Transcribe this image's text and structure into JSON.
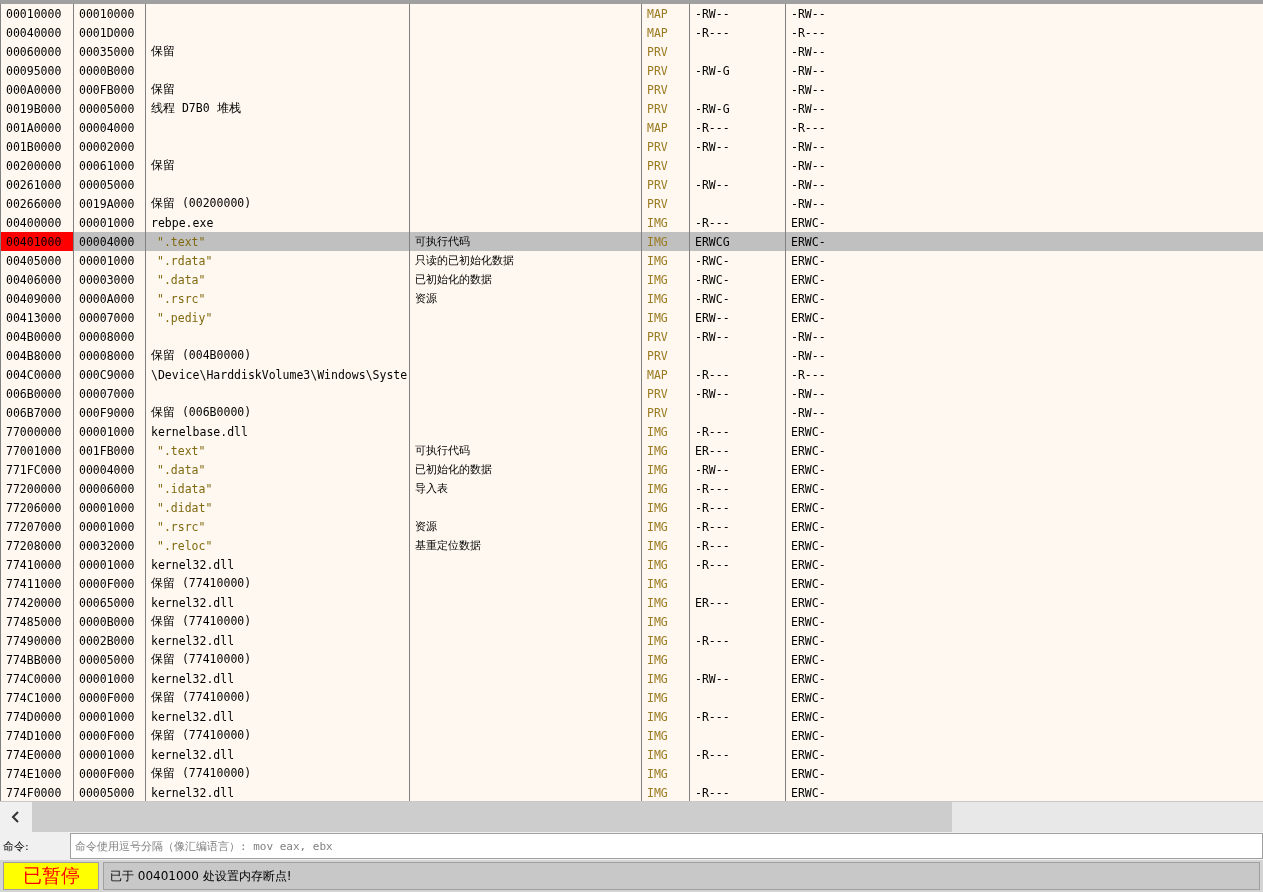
{
  "memory_table": {
    "rows": [
      {
        "column_1": "00010000",
        "column_2": "00010000",
        "column_5": "MAP",
        "column_6": "-RW--",
        "column_7": "-RW--",
        "kind": "plain",
        "selected": false
      },
      {
        "column_1": "00040000",
        "column_2": "0001D000",
        "column_5": "MAP",
        "column_6": "-R---",
        "column_7": "-R---",
        "kind": "plain",
        "selected": false
      },
      {
        "column_1": "00060000",
        "column_2": "00035000",
        "column_3": "保留",
        "column_5": "PRV",
        "column_7": "-RW--",
        "kind": "plain",
        "selected": false
      },
      {
        "column_1": "00095000",
        "column_2": "0000B000",
        "column_5": "PRV",
        "column_6": "-RW-G",
        "column_7": "-RW--",
        "kind": "plain",
        "selected": false
      },
      {
        "column_1": "000A0000",
        "column_2": "000FB000",
        "column_3": "保留",
        "column_5": "PRV",
        "column_7": "-RW--",
        "kind": "plain",
        "selected": false
      },
      {
        "column_1": "0019B000",
        "column_2": "00005000",
        "column_3": "线程 D7B0 堆栈",
        "column_5": "PRV",
        "column_6": "-RW-G",
        "column_7": "-RW--",
        "kind": "plain",
        "selected": false
      },
      {
        "column_1": "001A0000",
        "column_2": "00004000",
        "column_5": "MAP",
        "column_6": "-R---",
        "column_7": "-R---",
        "kind": "plain",
        "selected": false
      },
      {
        "column_1": "001B0000",
        "column_2": "00002000",
        "column_5": "PRV",
        "column_6": "-RW--",
        "column_7": "-RW--",
        "kind": "plain",
        "selected": false
      },
      {
        "column_1": "00200000",
        "column_2": "00061000",
        "column_3": "保留",
        "column_5": "PRV",
        "column_7": "-RW--",
        "kind": "plain",
        "selected": false
      },
      {
        "column_1": "00261000",
        "column_2": "00005000",
        "column_5": "PRV",
        "column_6": "-RW--",
        "column_7": "-RW--",
        "kind": "plain",
        "selected": false
      },
      {
        "column_1": "00266000",
        "column_2": "0019A000",
        "column_3": "保留 (00200000)",
        "column_5": "PRV",
        "column_7": "-RW--",
        "kind": "plain",
        "selected": false
      },
      {
        "column_1": "00400000",
        "column_2": "00001000",
        "column_3": "rebpe.exe",
        "column_5": "IMG",
        "column_6": "-R---",
        "column_7": "ERWC-",
        "kind": "plain",
        "selected": false
      },
      {
        "column_1": "00401000",
        "column_2": "00004000",
        "column_3": "\".text\"",
        "column_4": "可执行代码",
        "column_5": "IMG",
        "column_6": "ERWCG",
        "column_7": "ERWC-",
        "kind": "section",
        "selected": true
      },
      {
        "column_1": "00405000",
        "column_2": "00001000",
        "column_3": "\".rdata\"",
        "column_4": "只读的已初始化数据",
        "column_5": "IMG",
        "column_6": "-RWC-",
        "column_7": "ERWC-",
        "kind": "section",
        "selected": false
      },
      {
        "column_1": "00406000",
        "column_2": "00003000",
        "column_3": "\".data\"",
        "column_4": "已初始化的数据",
        "column_5": "IMG",
        "column_6": "-RWC-",
        "column_7": "ERWC-",
        "kind": "section",
        "selected": false
      },
      {
        "column_1": "00409000",
        "column_2": "0000A000",
        "column_3": "\".rsrc\"",
        "column_4": "资源",
        "column_5": "IMG",
        "column_6": "-RWC-",
        "column_7": "ERWC-",
        "kind": "section",
        "selected": false
      },
      {
        "column_1": "00413000",
        "column_2": "00007000",
        "column_3": "\".pediy\"",
        "column_5": "IMG",
        "column_6": "ERW--",
        "column_7": "ERWC-",
        "kind": "section",
        "selected": false
      },
      {
        "column_1": "004B0000",
        "column_2": "00008000",
        "column_5": "PRV",
        "column_6": "-RW--",
        "column_7": "-RW--",
        "kind": "plain",
        "selected": false
      },
      {
        "column_1": "004B8000",
        "column_2": "00008000",
        "column_3": "保留 (004B0000)",
        "column_5": "PRV",
        "column_7": "-RW--",
        "kind": "plain",
        "selected": false
      },
      {
        "column_1": "004C0000",
        "column_2": "000C9000",
        "column_3": "\\Device\\HarddiskVolume3\\Windows\\Syste",
        "column_5": "MAP",
        "column_6": "-R---",
        "column_7": "-R---",
        "kind": "plain",
        "selected": false
      },
      {
        "column_1": "006B0000",
        "column_2": "00007000",
        "column_5": "PRV",
        "column_6": "-RW--",
        "column_7": "-RW--",
        "kind": "plain",
        "selected": false
      },
      {
        "column_1": "006B7000",
        "column_2": "000F9000",
        "column_3": "保留 (006B0000)",
        "column_5": "PRV",
        "column_7": "-RW--",
        "kind": "plain",
        "selected": false
      },
      {
        "column_1": "77000000",
        "column_2": "00001000",
        "column_3": "kernelbase.dll",
        "column_5": "IMG",
        "column_6": "-R---",
        "column_7": "ERWC-",
        "kind": "plain",
        "selected": false
      },
      {
        "column_1": "77001000",
        "column_2": "001FB000",
        "column_3": "\".text\"",
        "column_4": "可执行代码",
        "column_5": "IMG",
        "column_6": "ER---",
        "column_7": "ERWC-",
        "kind": "section",
        "selected": false
      },
      {
        "column_1": "771FC000",
        "column_2": "00004000",
        "column_3": "\".data\"",
        "column_4": "已初始化的数据",
        "column_5": "IMG",
        "column_6": "-RW--",
        "column_7": "ERWC-",
        "kind": "section",
        "selected": false
      },
      {
        "column_1": "77200000",
        "column_2": "00006000",
        "column_3": "\".idata\"",
        "column_4": "导入表",
        "column_5": "IMG",
        "column_6": "-R---",
        "column_7": "ERWC-",
        "kind": "section",
        "selected": false
      },
      {
        "column_1": "77206000",
        "column_2": "00001000",
        "column_3": "\".didat\"",
        "column_5": "IMG",
        "column_6": "-R---",
        "column_7": "ERWC-",
        "kind": "section",
        "selected": false
      },
      {
        "column_1": "77207000",
        "column_2": "00001000",
        "column_3": "\".rsrc\"",
        "column_4": "资源",
        "column_5": "IMG",
        "column_6": "-R---",
        "column_7": "ERWC-",
        "kind": "section",
        "selected": false
      },
      {
        "column_1": "77208000",
        "column_2": "00032000",
        "column_3": "\".reloc\"",
        "column_4": "基重定位数据",
        "column_5": "IMG",
        "column_6": "-R---",
        "column_7": "ERWC-",
        "kind": "section",
        "selected": false
      },
      {
        "column_1": "77410000",
        "column_2": "00001000",
        "column_3": "kernel32.dll",
        "column_5": "IMG",
        "column_6": "-R---",
        "column_7": "ERWC-",
        "kind": "plain",
        "selected": false
      },
      {
        "column_1": "77411000",
        "column_2": "0000F000",
        "column_3": "保留 (77410000)",
        "column_5": "IMG",
        "column_7": "ERWC-",
        "kind": "plain",
        "selected": false
      },
      {
        "column_1": "77420000",
        "column_2": "00065000",
        "column_3": "kernel32.dll",
        "column_5": "IMG",
        "column_6": "ER---",
        "column_7": "ERWC-",
        "kind": "plain",
        "selected": false
      },
      {
        "column_1": "77485000",
        "column_2": "0000B000",
        "column_3": "保留 (77410000)",
        "column_5": "IMG",
        "column_7": "ERWC-",
        "kind": "plain",
        "selected": false
      },
      {
        "column_1": "77490000",
        "column_2": "0002B000",
        "column_3": "kernel32.dll",
        "column_5": "IMG",
        "column_6": "-R---",
        "column_7": "ERWC-",
        "kind": "plain",
        "selected": false
      },
      {
        "column_1": "774BB000",
        "column_2": "00005000",
        "column_3": "保留 (77410000)",
        "column_5": "IMG",
        "column_7": "ERWC-",
        "kind": "plain",
        "selected": false
      },
      {
        "column_1": "774C0000",
        "column_2": "00001000",
        "column_3": "kernel32.dll",
        "column_5": "IMG",
        "column_6": "-RW--",
        "column_7": "ERWC-",
        "kind": "plain",
        "selected": false
      },
      {
        "column_1": "774C1000",
        "column_2": "0000F000",
        "column_3": "保留 (77410000)",
        "column_5": "IMG",
        "column_7": "ERWC-",
        "kind": "plain",
        "selected": false
      },
      {
        "column_1": "774D0000",
        "column_2": "00001000",
        "column_3": "kernel32.dll",
        "column_5": "IMG",
        "column_6": "-R---",
        "column_7": "ERWC-",
        "kind": "plain",
        "selected": false
      },
      {
        "column_1": "774D1000",
        "column_2": "0000F000",
        "column_3": "保留 (77410000)",
        "column_5": "IMG",
        "column_7": "ERWC-",
        "kind": "plain",
        "selected": false
      },
      {
        "column_1": "774E0000",
        "column_2": "00001000",
        "column_3": "kernel32.dll",
        "column_5": "IMG",
        "column_6": "-R---",
        "column_7": "ERWC-",
        "kind": "plain",
        "selected": false
      },
      {
        "column_1": "774E1000",
        "column_2": "0000F000",
        "column_3": "保留 (77410000)",
        "column_5": "IMG",
        "column_7": "ERWC-",
        "kind": "plain",
        "selected": false
      },
      {
        "column_1": "774F0000",
        "column_2": "00005000",
        "column_3": "kernel32.dll",
        "column_5": "IMG",
        "column_6": "-R---",
        "column_7": "ERWC-",
        "kind": "plain",
        "selected": false
      }
    ]
  },
  "command_bar": {
    "label": "命令:",
    "placeholder": "命令使用逗号分隔（像汇编语言）: mov eax, ebx"
  },
  "status_bar": {
    "state": "已暂停",
    "message": "已于 00401000 处设置内存断点!"
  }
}
